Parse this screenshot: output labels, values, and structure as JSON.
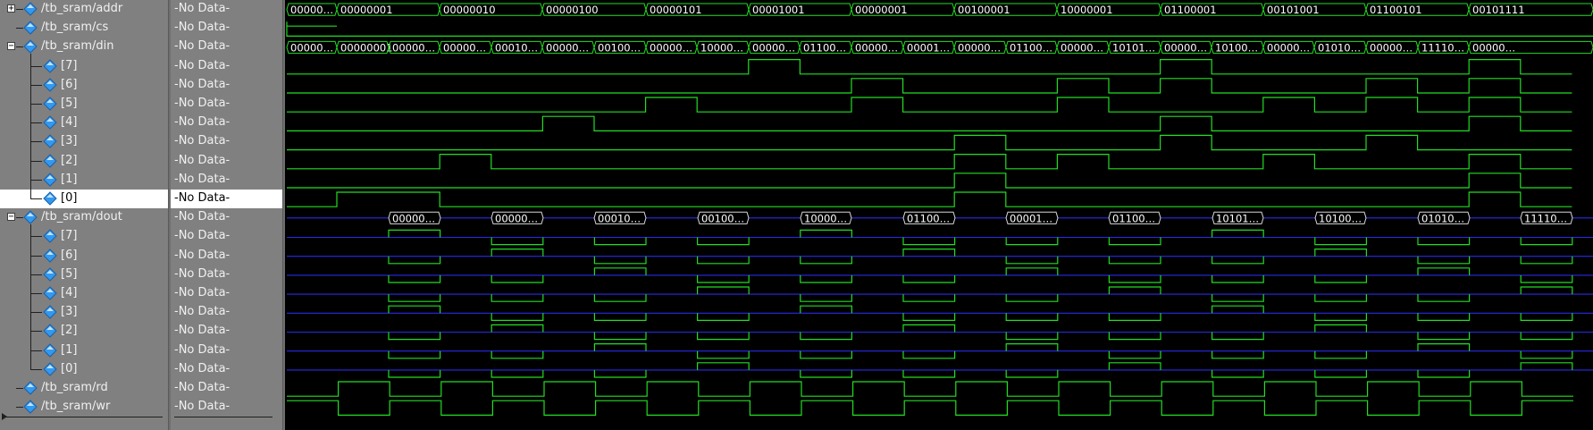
{
  "signals": [
    {
      "name": "/tb_sram/addr",
      "indent": 0,
      "expander": "+",
      "value": "-No Data-"
    },
    {
      "name": "/tb_sram/cs",
      "indent": 0,
      "expander": "",
      "value": "-No Data-"
    },
    {
      "name": "/tb_sram/din",
      "indent": 0,
      "expander": "-",
      "value": "-No Data-"
    },
    {
      "name": "[7]",
      "indent": 1,
      "expander": "",
      "value": "-No Data-"
    },
    {
      "name": "[6]",
      "indent": 1,
      "expander": "",
      "value": "-No Data-"
    },
    {
      "name": "[5]",
      "indent": 1,
      "expander": "",
      "value": "-No Data-"
    },
    {
      "name": "[4]",
      "indent": 1,
      "expander": "",
      "value": "-No Data-"
    },
    {
      "name": "[3]",
      "indent": 1,
      "expander": "",
      "value": "-No Data-"
    },
    {
      "name": "[2]",
      "indent": 1,
      "expander": "",
      "value": "-No Data-"
    },
    {
      "name": "[1]",
      "indent": 1,
      "expander": "",
      "value": "-No Data-"
    },
    {
      "name": "[0]",
      "indent": 1,
      "expander": "",
      "value": "-No Data-",
      "selected": true
    },
    {
      "name": "/tb_sram/dout",
      "indent": 0,
      "expander": "-",
      "value": "-No Data-"
    },
    {
      "name": "[7]",
      "indent": 1,
      "expander": "",
      "value": "-No Data-"
    },
    {
      "name": "[6]",
      "indent": 1,
      "expander": "",
      "value": "-No Data-"
    },
    {
      "name": "[5]",
      "indent": 1,
      "expander": "",
      "value": "-No Data-"
    },
    {
      "name": "[4]",
      "indent": 1,
      "expander": "",
      "value": "-No Data-"
    },
    {
      "name": "[3]",
      "indent": 1,
      "expander": "",
      "value": "-No Data-"
    },
    {
      "name": "[2]",
      "indent": 1,
      "expander": "",
      "value": "-No Data-"
    },
    {
      "name": "[1]",
      "indent": 1,
      "expander": "",
      "value": "-No Data-"
    },
    {
      "name": "[0]",
      "indent": 1,
      "expander": "",
      "value": "-No Data-"
    },
    {
      "name": "/tb_sram/rd",
      "indent": 0,
      "expander": "",
      "value": "-No Data-"
    },
    {
      "name": "/tb_sram/wr",
      "indent": 0,
      "expander": "",
      "value": "-No Data-"
    }
  ],
  "waves": {
    "addr_labels": [
      "00000…",
      "00000001",
      "00000010",
      "00000100",
      "00000101",
      "00001001",
      "00000001",
      "00100001",
      "10000001",
      "01100001",
      "00101001",
      "01100101",
      "00101111"
    ],
    "din_labels": [
      "00000…",
      "00000001",
      "00000…",
      "00000…",
      "00010…",
      "00000…",
      "00100…",
      "00000…",
      "10000…",
      "00000…",
      "01100…",
      "00000…",
      "00001…",
      "00000…",
      "01100…",
      "00000…",
      "10101…",
      "00000…",
      "10100…",
      "00000…",
      "01010…",
      "00000…",
      "11110…",
      "00000…"
    ],
    "dout_labels": [
      "00000…",
      "00000…",
      "00010…",
      "00100…",
      "10000…",
      "01100…",
      "00001…",
      "01100…",
      "10101…",
      "10100…",
      "01010…",
      "11110…"
    ]
  },
  "colors": {
    "trace": "#22dd22",
    "undefined": "#2a2ae8",
    "bus_label": "#ffffff",
    "icon": "#3399ee"
  }
}
